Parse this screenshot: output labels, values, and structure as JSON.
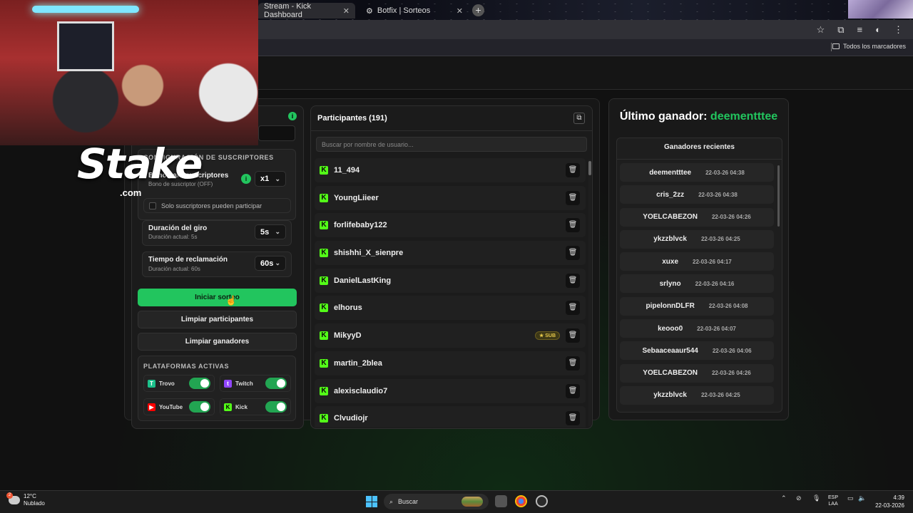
{
  "browser": {
    "tabs": [
      {
        "label": "Stream - Kick Dashboard"
      },
      {
        "label": "Botfix | Sorteos"
      }
    ],
    "bookmarks_all": "Todos los marcadores"
  },
  "overlay": {
    "logo": "Stake",
    "logo_sub": ".com"
  },
  "left": {
    "sub_config_title": "CONFIGURACIÓN DE SUSCRIPTORES",
    "sub_bonus_title": "Bono para suscriptores",
    "sub_bonus_sub": "Bono de suscriptor (OFF)",
    "sub_multiplier": "x1",
    "only_subs_label": "Solo suscriptores pueden participar",
    "spin_title": "Duración del giro",
    "spin_sub": "Duración actual: 5s",
    "spin_value": "5s",
    "claim_title": "Tiempo de reclamación",
    "claim_sub": "Duración actual: 60s",
    "claim_value": "60s",
    "start_button": "Iniciar sorteo",
    "clear_participants": "Limpiar participantes",
    "clear_winners": "Limpiar ganadores",
    "platforms_title": "PLATAFORMAS ACTIVAS",
    "platforms": [
      {
        "name": "Trovo",
        "icon": "trovo-icon",
        "color": "#1bc08a",
        "enabled": true
      },
      {
        "name": "Twitch",
        "icon": "twitch-icon",
        "color": "#9146ff",
        "enabled": true
      },
      {
        "name": "YouTube",
        "icon": "youtube-icon",
        "color": "#ff0000",
        "enabled": true
      },
      {
        "name": "Kick",
        "icon": "kick-icon",
        "color": "#53fc18",
        "enabled": true
      }
    ]
  },
  "participants": {
    "title": "Participantes (191)",
    "search_placeholder": "Buscar por nombre de usuario...",
    "items": [
      {
        "name": "11_494",
        "sub": false
      },
      {
        "name": "YoungLiieer",
        "sub": false
      },
      {
        "name": "forlifebaby122",
        "sub": false
      },
      {
        "name": "shishhi_X_sienpre",
        "sub": false
      },
      {
        "name": "DanielLastKing",
        "sub": false
      },
      {
        "name": "elhorus",
        "sub": false
      },
      {
        "name": "MikyyD",
        "sub": true,
        "badge": "SUB"
      },
      {
        "name": "martin_2blea",
        "sub": false
      },
      {
        "name": "alexisclaudio7",
        "sub": false
      },
      {
        "name": "Clvudiojr",
        "sub": false
      }
    ]
  },
  "winners": {
    "title_prefix": "Último ganador: ",
    "last_winner": "deementttee",
    "recent_title": "Ganadores recientes",
    "items": [
      {
        "name": "deementttee",
        "time": "22-03-26 04:38"
      },
      {
        "name": "cris_2zz",
        "time": "22-03-26 04:38"
      },
      {
        "name": "YOELCABEZON",
        "time": "22-03-26 04:26"
      },
      {
        "name": "ykzzblvck",
        "time": "22-03-26 04:25"
      },
      {
        "name": "xuxe",
        "time": "22-03-26 04:17"
      },
      {
        "name": "srlyno",
        "time": "22-03-26 04:16"
      },
      {
        "name": "pipelonnDLFR",
        "time": "22-03-26 04:08"
      },
      {
        "name": "keooo0",
        "time": "22-03-26 04:07"
      },
      {
        "name": "Sebaaceaaur544",
        "time": "22-03-26 04:06"
      },
      {
        "name": "YOELCABEZON",
        "time": "22-03-26 04:26"
      },
      {
        "name": "ykzzblvck",
        "time": "22-03-26 04:25"
      }
    ]
  },
  "taskbar": {
    "temp": "12°C",
    "condition": "Nublado",
    "weather_badge": "2",
    "search_label": "Buscar",
    "lang1": "ESP",
    "lang2": "LAA",
    "time": "4:39",
    "date": "22-03-2026"
  },
  "colors": {
    "accent": "#22c55e",
    "kick": "#53fc18",
    "background": "#121212"
  }
}
